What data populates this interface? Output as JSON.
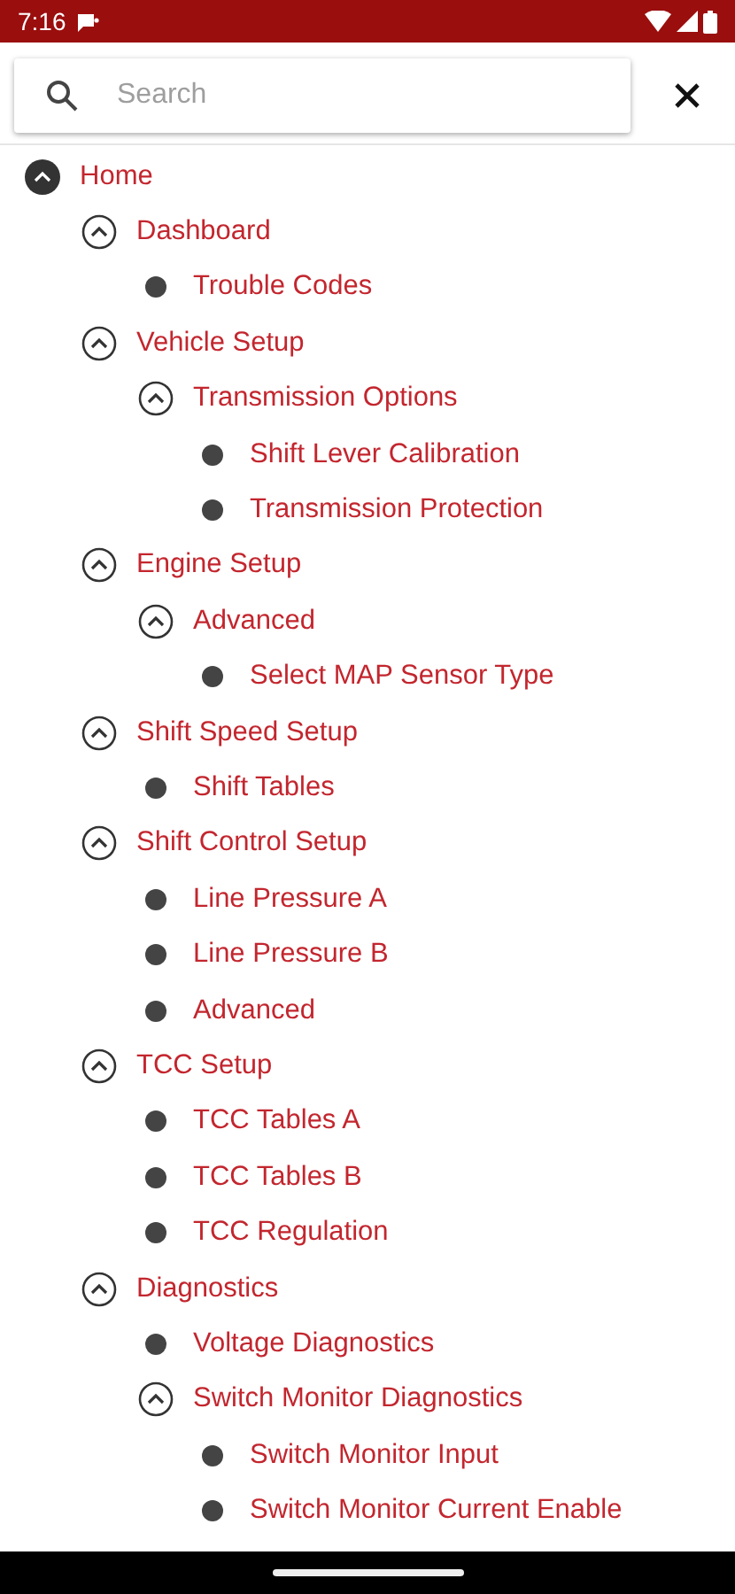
{
  "status_bar": {
    "time": "7:16"
  },
  "search": {
    "placeholder": "Search"
  },
  "tree": [
    {
      "label": "Home",
      "expanded": true,
      "children": [
        {
          "label": "Dashboard",
          "expanded": true,
          "children": [
            {
              "label": "Trouble Codes"
            }
          ]
        },
        {
          "label": "Vehicle Setup",
          "expanded": true,
          "children": [
            {
              "label": "Transmission Options",
              "expanded": true,
              "children": [
                {
                  "label": "Shift Lever Calibration"
                },
                {
                  "label": "Transmission Protection"
                }
              ]
            }
          ]
        },
        {
          "label": "Engine Setup",
          "expanded": true,
          "children": [
            {
              "label": "Advanced",
              "expanded": true,
              "children": [
                {
                  "label": "Select MAP Sensor Type"
                }
              ]
            }
          ]
        },
        {
          "label": "Shift Speed Setup",
          "expanded": true,
          "children": [
            {
              "label": "Shift Tables"
            }
          ]
        },
        {
          "label": "Shift Control Setup",
          "expanded": true,
          "children": [
            {
              "label": "Line Pressure A"
            },
            {
              "label": "Line Pressure B"
            },
            {
              "label": "Advanced"
            }
          ]
        },
        {
          "label": "TCC Setup",
          "expanded": true,
          "children": [
            {
              "label": "TCC Tables A"
            },
            {
              "label": "TCC Tables B"
            },
            {
              "label": "TCC Regulation"
            }
          ]
        },
        {
          "label": "Diagnostics",
          "expanded": true,
          "children": [
            {
              "label": "Voltage Diagnostics"
            },
            {
              "label": "Switch Monitor Diagnostics",
              "expanded": true,
              "children": [
                {
                  "label": "Switch Monitor Input"
                },
                {
                  "label": "Switch Monitor Current Enable"
                }
              ]
            }
          ]
        }
      ]
    }
  ]
}
